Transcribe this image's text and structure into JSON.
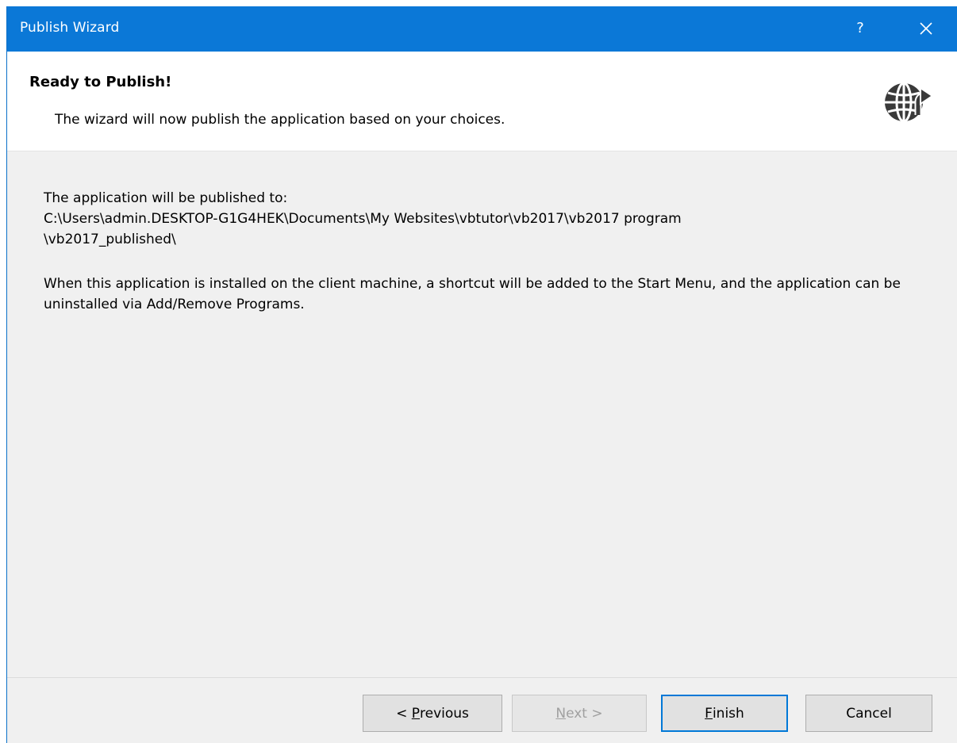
{
  "window": {
    "title": "Publish Wizard",
    "help_label": "?",
    "accent_color": "#0b78d7"
  },
  "header": {
    "heading": "Ready to Publish!",
    "subheading": "The wizard will now publish the application based on your choices.",
    "icon": "globe-publish-icon"
  },
  "content": {
    "publish_intro": "The application will be published to:",
    "publish_path_line1": "C:\\Users\\admin.DESKTOP-G1G4HEK\\Documents\\My Websites\\vbtutor\\vb2017\\vb2017 program",
    "publish_path_line2": "\\vb2017_published\\",
    "install_note": "When this application is installed on the client machine, a shortcut will be added to the Start Menu, and the application can be uninstalled via Add/Remove Programs."
  },
  "buttons": {
    "previous_prefix": "< ",
    "previous_accel": "P",
    "previous_rest": "revious",
    "next_accel": "N",
    "next_rest": "ext >",
    "finish_accel": "F",
    "finish_rest": "inish",
    "cancel": "Cancel"
  }
}
